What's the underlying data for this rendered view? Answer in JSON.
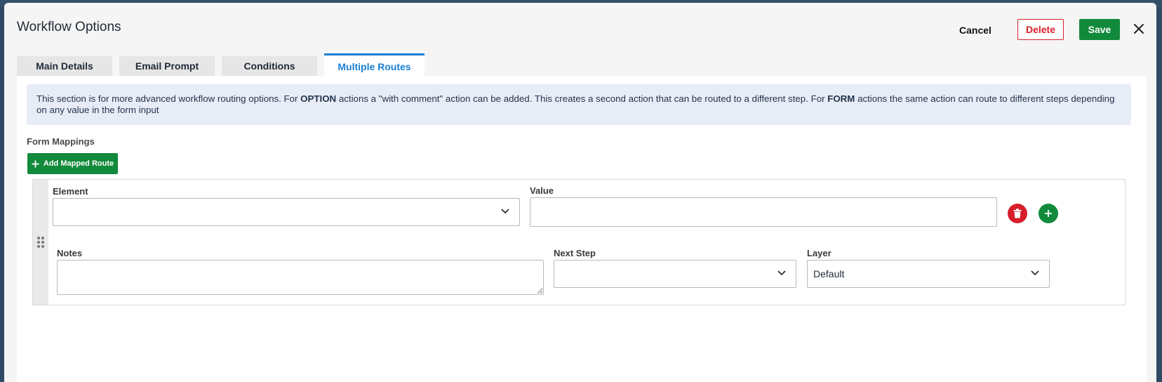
{
  "modal": {
    "title": "Workflow Options",
    "cancel_label": "Cancel",
    "delete_label": "Delete",
    "save_label": "Save"
  },
  "tabs": [
    {
      "label": "Main Details",
      "active": false
    },
    {
      "label": "Email Prompt",
      "active": false
    },
    {
      "label": "Conditions",
      "active": false
    },
    {
      "label": "Multiple Routes",
      "active": true
    }
  ],
  "info": {
    "p1": "This section is for more advanced workflow routing options. For ",
    "b1": "OPTION",
    "p2": " actions a \"with comment\" action can be added. This creates a second action that can be routed to a different step. For ",
    "b2": "FORM",
    "p3": " actions the same action can route to different steps depending on any value in the form input"
  },
  "form_mappings": {
    "label": "Form Mappings",
    "add_button_label": "Add Mapped Route"
  },
  "route": {
    "element_label": "Element",
    "element_value": "",
    "value_label": "Value",
    "value_value": "",
    "notes_label": "Notes",
    "notes_value": "",
    "next_step_label": "Next Step",
    "next_step_value": "",
    "layer_label": "Layer",
    "layer_value": "Default"
  },
  "colors": {
    "accent": "#1a7fd4",
    "success": "#128a3b",
    "danger": "#d61f2b",
    "info_bg": "#e7ecf7"
  },
  "icons": {
    "close": "close-icon",
    "plus": "plus-icon",
    "trash": "trash-icon",
    "drag": "drag-handle-icon",
    "chevron": "chevron-down-icon"
  }
}
